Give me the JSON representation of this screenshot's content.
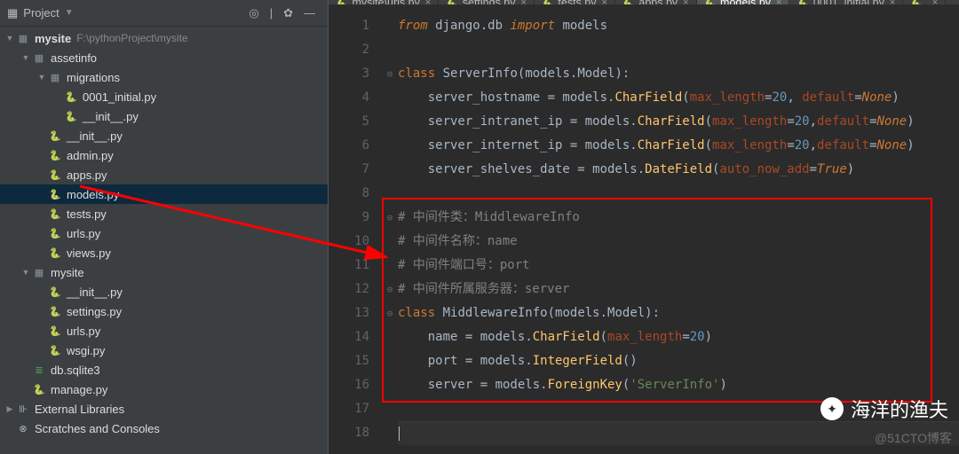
{
  "sidebar": {
    "title": "Project",
    "root": {
      "name": "mysite",
      "path": "F:\\pythonProject\\mysite"
    },
    "nodes": [
      {
        "name": "assetinfo",
        "t": "folder",
        "d": 1,
        "ex": true
      },
      {
        "name": "migrations",
        "t": "folder",
        "d": 2,
        "ex": true
      },
      {
        "name": "0001_initial.py",
        "t": "py",
        "d": 3
      },
      {
        "name": "__init__.py",
        "t": "py",
        "d": 3
      },
      {
        "name": "__init__.py",
        "t": "py",
        "d": 2
      },
      {
        "name": "admin.py",
        "t": "py",
        "d": 2
      },
      {
        "name": "apps.py",
        "t": "py",
        "d": 2
      },
      {
        "name": "models.py",
        "t": "py",
        "d": 2,
        "sel": true
      },
      {
        "name": "tests.py",
        "t": "py",
        "d": 2
      },
      {
        "name": "urls.py",
        "t": "py",
        "d": 2
      },
      {
        "name": "views.py",
        "t": "py",
        "d": 2
      },
      {
        "name": "mysite",
        "t": "folder",
        "d": 1,
        "ex": true
      },
      {
        "name": "__init__.py",
        "t": "py",
        "d": 2
      },
      {
        "name": "settings.py",
        "t": "py",
        "d": 2
      },
      {
        "name": "urls.py",
        "t": "py",
        "d": 2
      },
      {
        "name": "wsgi.py",
        "t": "py",
        "d": 2
      },
      {
        "name": "db.sqlite3",
        "t": "db",
        "d": 1
      },
      {
        "name": "manage.py",
        "t": "py",
        "d": 1
      }
    ],
    "extras": [
      {
        "name": "External Libraries",
        "t": "lib"
      },
      {
        "name": "Scratches and Consoles",
        "t": "scratch"
      }
    ]
  },
  "tabs": [
    {
      "name": "mysite\\urls.py"
    },
    {
      "name": "settings.py"
    },
    {
      "name": "tests.py"
    },
    {
      "name": "apps.py"
    },
    {
      "name": "models.py",
      "active": true
    },
    {
      "name": "0001_initial.py"
    },
    {
      "name": ""
    }
  ],
  "code": {
    "lines": [
      {
        "n": 1,
        "html": "<span class='kw'>from</span> django.db <span class='kw'>import</span> models"
      },
      {
        "n": 2,
        "html": ""
      },
      {
        "n": 3,
        "html": "<span class='kw2'>class</span> <span class='cls'>ServerInfo</span>(models.Model):",
        "fold": "-"
      },
      {
        "n": 4,
        "html": "    server_hostname = models.<span class='fn'>CharField</span>(<span class='par'>max_length</span>=<span class='num'>20</span>, <span class='par'>default</span>=<span class='val'>None</span>)"
      },
      {
        "n": 5,
        "html": "    server_intranet_ip = models.<span class='fn'>CharField</span>(<span class='par'>max_length</span>=<span class='num'>20</span>,<span class='par'>default</span>=<span class='val'>None</span>)"
      },
      {
        "n": 6,
        "html": "    server_internet_ip = models.<span class='fn'>CharField</span>(<span class='par'>max_length</span>=<span class='num'>20</span>,<span class='par'>default</span>=<span class='val'>None</span>)"
      },
      {
        "n": 7,
        "html": "    server_shelves_date = models.<span class='fn'>DateField</span>(<span class='par'>auto_now_add</span>=<span class='val'>True</span>)"
      },
      {
        "n": 8,
        "html": ""
      },
      {
        "n": 9,
        "html": "<span class='cmt'># 中间件类：MiddlewareInfo</span>",
        "fold": "-"
      },
      {
        "n": 10,
        "html": "<span class='cmt'># 中间件名称：name</span>"
      },
      {
        "n": 11,
        "html": "<span class='cmt'># 中间件端口号：port</span>"
      },
      {
        "n": 12,
        "html": "<span class='cmt'># 中间件所属服务器：server</span>",
        "fold": "-"
      },
      {
        "n": 13,
        "html": "<span class='kw2'>class</span> <span class='cls'>MiddlewareInfo</span>(models.Model):",
        "fold": "-"
      },
      {
        "n": 14,
        "html": "    name = models.<span class='fn'>CharField</span>(<span class='par'>max_length</span>=<span class='num'>20</span>)"
      },
      {
        "n": 15,
        "html": "    port = models.<span class='fn'>IntegerField</span>()"
      },
      {
        "n": 16,
        "html": "    server = models.<span class='fn'>ForeignKey</span>(<span class='str'>'ServerInfo'</span>)"
      },
      {
        "n": 17,
        "html": ""
      },
      {
        "n": 18,
        "html": "<span class='cursor'></span>",
        "hl": true
      }
    ]
  },
  "watermark": {
    "text": "海洋的渔夫",
    "sub": "@51CTO博客"
  }
}
